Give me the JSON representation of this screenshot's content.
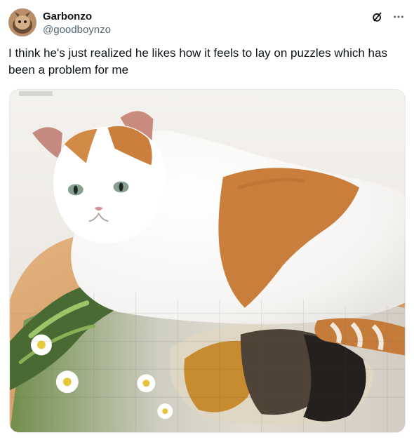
{
  "tweet": {
    "author": {
      "display_name": "Garbonzo",
      "handle": "@goodboynzo"
    },
    "text": "I think he's just realized he likes how it feels to lay on puzzles which has been a problem for me",
    "icons": {
      "grok": "grok-icon",
      "more": "more-icon"
    }
  },
  "colors": {
    "text": "#0f1419",
    "secondary_text": "#536471",
    "card_border": "#e6e9ec"
  }
}
